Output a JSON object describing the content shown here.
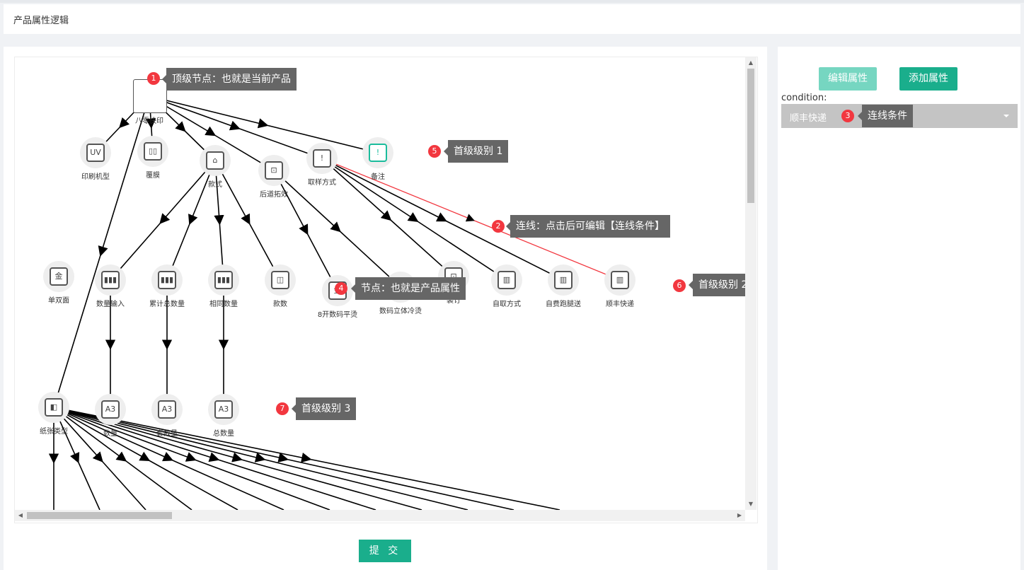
{
  "header": {
    "title": "产品属性逻辑"
  },
  "root_node": {
    "label": "八零快印"
  },
  "level1_nodes": [
    {
      "id": "n_uv",
      "label": "印刷机型",
      "icon": "uv-icon",
      "glyph": "UV"
    },
    {
      "id": "n_film",
      "label": "覆膜",
      "icon": "film-icon",
      "glyph": "▯▯"
    },
    {
      "id": "n_style",
      "label": "款式",
      "icon": "style-icon",
      "glyph": "⌂"
    },
    {
      "id": "n_post",
      "label": "后道拓效",
      "icon": "crop-icon",
      "glyph": "⊡"
    },
    {
      "id": "n_sample",
      "label": "取样方式",
      "icon": "alert-icon",
      "glyph": "!"
    },
    {
      "id": "n_note",
      "label": "备注",
      "icon": "note-icon",
      "glyph": "!"
    }
  ],
  "level2_nodes": [
    {
      "id": "n_side",
      "label": "单双面",
      "icon": "side-icon",
      "glyph": "金"
    },
    {
      "id": "n_qty_in",
      "label": "数量输入",
      "icon": "books-icon",
      "glyph": "▮▮▮"
    },
    {
      "id": "n_total",
      "label": "累计总数量",
      "icon": "books-icon",
      "glyph": "▮▮▮"
    },
    {
      "id": "n_same",
      "label": "相同数量",
      "icon": "books-icon",
      "glyph": "▮▮▮"
    },
    {
      "id": "n_count",
      "label": "款数",
      "icon": "layout-icon",
      "glyph": "◫"
    },
    {
      "id": "n_8k",
      "label": "8开数码平烫",
      "icon": "gold-icon",
      "glyph": "金"
    },
    {
      "id": "n_3d",
      "label": "数码立体冷烫",
      "icon": "gold-icon",
      "glyph": "金"
    },
    {
      "id": "n_bind",
      "label": "装订",
      "icon": "crop-icon",
      "glyph": "⊡"
    },
    {
      "id": "n_pickup",
      "label": "自取方式",
      "icon": "bar-chart-icon",
      "glyph": "▥"
    },
    {
      "id": "n_run",
      "label": "自费跑腿送",
      "icon": "bar-chart-icon",
      "glyph": "▥"
    },
    {
      "id": "n_sf",
      "label": "顺丰快递",
      "icon": "bar-chart-icon",
      "glyph": "▥"
    }
  ],
  "level3_nodes": [
    {
      "id": "n_paper",
      "label": "纸张类型",
      "icon": "paper-icon",
      "glyph": "◧"
    },
    {
      "id": "n_qty",
      "label": "数量",
      "icon": "a3-icon",
      "glyph": "A3"
    },
    {
      "id": "n_setqty",
      "label": "套数量",
      "icon": "a3-icon",
      "glyph": "A3"
    },
    {
      "id": "n_totalqty",
      "label": "总数量",
      "icon": "a3-icon",
      "glyph": "A3"
    }
  ],
  "annotations": [
    {
      "num": "1",
      "text": "顶级节点：也就是当前产品"
    },
    {
      "num": "2",
      "text": "连线：点击后可编辑【连线条件】"
    },
    {
      "num": "3",
      "text": "连线条件"
    },
    {
      "num": "4",
      "text": "节点：也就是产品属性"
    },
    {
      "num": "5",
      "text": "首级级别 1"
    },
    {
      "num": "6",
      "text": "首级级别 2"
    },
    {
      "num": "7",
      "text": "首级级别 3"
    }
  ],
  "sidebar": {
    "edit_label": "编辑属性",
    "add_label": "添加属性",
    "condition_label": "condition:",
    "condition_value": "顺丰快递"
  },
  "footer": {
    "submit_label": "提 交"
  },
  "colors": {
    "accent": "#1aae8c",
    "accent_light": "#76d6c1",
    "badge": "#f2373f",
    "tooltip": "#666666",
    "selected_edge": "#f2373f"
  }
}
